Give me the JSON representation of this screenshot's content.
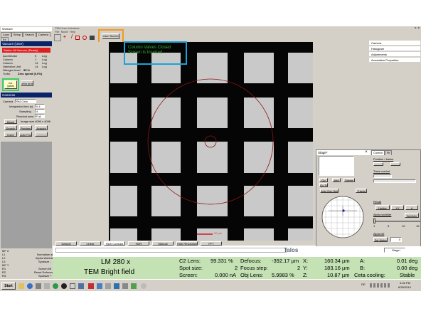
{
  "left_panel": {
    "title": "Workset",
    "tabs": [
      "Lops",
      "Setup",
      "Search",
      "Camera",
      "Ex"
    ],
    "vacuum_title": "Vacuum (User)",
    "vacuum_status": "Status: All Vacuum (Ready)",
    "vacuum_rows": [
      {
        "label": "Accelerator",
        "value": "5",
        "unit": "Log"
      },
      {
        "label": "Column",
        "value": "1",
        "unit": "Log"
      },
      {
        "label": "Column",
        "value": "14",
        "unit": "Log"
      },
      {
        "label": "Detection Unit",
        "value": "14",
        "unit": "Log"
      },
      {
        "label": "Nitrogen level",
        "value": "95 %",
        "unit": ""
      },
      {
        "label": "Turbo",
        "value": "Zero speed (0.0%)",
        "unit": ""
      }
    ],
    "col_valve_label": "Col. Valves Closed",
    "turbo_pump_label": "urbo pump",
    "camera_title": "Cameras",
    "camera_label": "Camera",
    "camera_value": "BM-Ceta",
    "integration_label": "Integration time (s)",
    "integration_value": "0.4",
    "sampling_label": "Sampling",
    "sampling_value": "4",
    "readout_label": "Readout area",
    "readout_value": "Full",
    "image_size_label": "Image size",
    "image_size_value": "4096 x 4096",
    "buttons": [
      "Blank",
      "Search",
      "Preview",
      "Acquire",
      "Insert",
      "Auto Focus",
      "Continuous"
    ],
    "bottom_rows": [
      {
        "key": "MF X",
        "val": ""
      },
      {
        "key": "L1",
        "val": "Normalize all"
      },
      {
        "key": "L2",
        "val": "Alpha Wobbler"
      },
      {
        "key": "L3",
        "val": "Spotsize -"
      },
      {
        "key": "MF Y",
        "val": ""
      },
      {
        "key": "R1",
        "val": "Screen lift"
      },
      {
        "key": "R2",
        "val": "Reset Defocus"
      },
      {
        "key": "R3",
        "val": "Spotsize +"
      }
    ]
  },
  "main": {
    "title": "TEM User Interface",
    "menus": [
      "File",
      "Mode",
      "Help"
    ],
    "insert_screen_label": "Insert Screen",
    "overlay_line1": "Column Valves Closed",
    "overlay_line2": "Screen is Inserted",
    "scale_label": "20 µm",
    "bottom_tabs": [
      "Natural",
      "Linear",
      "High Contrast",
      "HDR",
      "Manual",
      "High Resolution",
      "FFT"
    ]
  },
  "stage": {
    "title": "Stage*",
    "tabs": [
      "Control",
      "Fit"
    ],
    "buttons": [
      "Go",
      "Add",
      "Delete",
      "Go To",
      "Auto Euc Height",
      "Tracks"
    ],
    "position_label": "Position / tracks",
    "trace_label": "Trace control",
    "recall_label": "Recall",
    "holder_label": "Holder",
    "xy_label": "XY",
    "a_label": "A",
    "alpha_wobbler_label": "Alpha wobbler",
    "wobbler_label": "Wobbler",
    "alpha_tilt_label": "Alpha tilt",
    "set_alpha_label": "Set Alpha",
    "alpha_value": "0",
    "slider_ticks": [
      "1",
      "5",
      "10",
      "15"
    ]
  },
  "right_panel": {
    "items": [
      "Camera",
      "Histogram",
      "Adjustments",
      "Annotation Properties"
    ]
  },
  "status_bar": {
    "brand": "Talos",
    "selector_value": "Stage*",
    "mag_line1": "LM 280 x",
    "mag_line2": "TEM Bright field",
    "c2_label": "C2 Lens:",
    "c2_value": "99.331 %",
    "spot_label": "Spot size:",
    "spot_value": "2",
    "screen_label": "Screen:",
    "screen_value": "0.000 nA",
    "defocus_label": "Defocus:",
    "defocus_value": "-392.17 µm",
    "focus_step_label": "Focus step:",
    "focus_step_value": "2",
    "obj_label": "Obj Lens:",
    "obj_value": "5.9983 %",
    "x_label": "X:",
    "x_value": "160.34 µm",
    "y_label": "Y:",
    "y_value": "183.16 µm",
    "z_label": "Z:",
    "z_value": "10.87 µm",
    "a_label": "A:",
    "a_value": "0.01 deg",
    "b_label": "B:",
    "b_value": "0.00 deg",
    "ceta_label": "Ceta cooling:",
    "ceta_value": "Stable"
  },
  "taskbar": {
    "start_label": "Start",
    "lang": "DE",
    "time": "4:46 PM",
    "date": "6/28/2019"
  },
  "colors": {
    "highlight_orange": "#f39a1e",
    "highlight_blue": "#1aa3d9",
    "highlight_green": "#3dd05b",
    "status_green": "#c4e2b4",
    "vacuum_red": "#e02020"
  }
}
